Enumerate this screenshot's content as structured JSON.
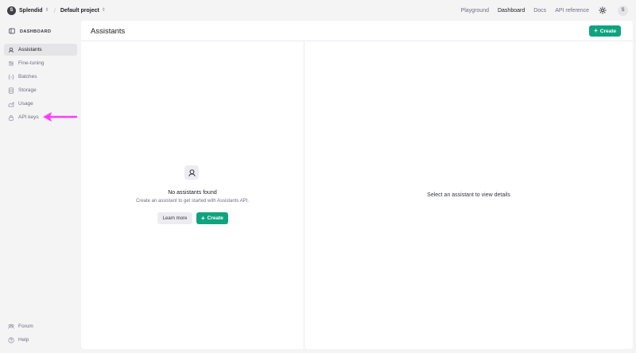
{
  "topbar": {
    "org_initial": "S",
    "org_name": "Splendid",
    "separator": "/",
    "project_name": "Default project",
    "nav": [
      "Playground",
      "Dashboard",
      "Docs",
      "API reference"
    ],
    "active_nav": "Dashboard",
    "user_initial": "S"
  },
  "sidebar": {
    "header": "DASHBOARD",
    "items": [
      {
        "label": "Assistants",
        "icon": "assistant-icon",
        "active": true
      },
      {
        "label": "Fine-tuning",
        "icon": "fine-tuning-icon",
        "active": false
      },
      {
        "label": "Batches",
        "icon": "batches-icon",
        "active": false
      },
      {
        "label": "Storage",
        "icon": "storage-icon",
        "active": false
      },
      {
        "label": "Usage",
        "icon": "usage-icon",
        "active": false
      },
      {
        "label": "API keys",
        "icon": "lock-icon",
        "active": false
      }
    ],
    "footer": [
      {
        "label": "Forum",
        "icon": "forum-icon"
      },
      {
        "label": "Help",
        "icon": "help-icon"
      }
    ]
  },
  "main": {
    "title": "Assistants",
    "create_label": "Create",
    "empty": {
      "title": "No assistants found",
      "subtitle": "Create an assistant to get started with Assistants API.",
      "learn_more": "Learn more",
      "create_label": "Create"
    },
    "detail_placeholder": "Select an assistant to view details"
  },
  "colors": {
    "accent": "#10a37f",
    "annotation_arrow": "#ff3dff"
  }
}
